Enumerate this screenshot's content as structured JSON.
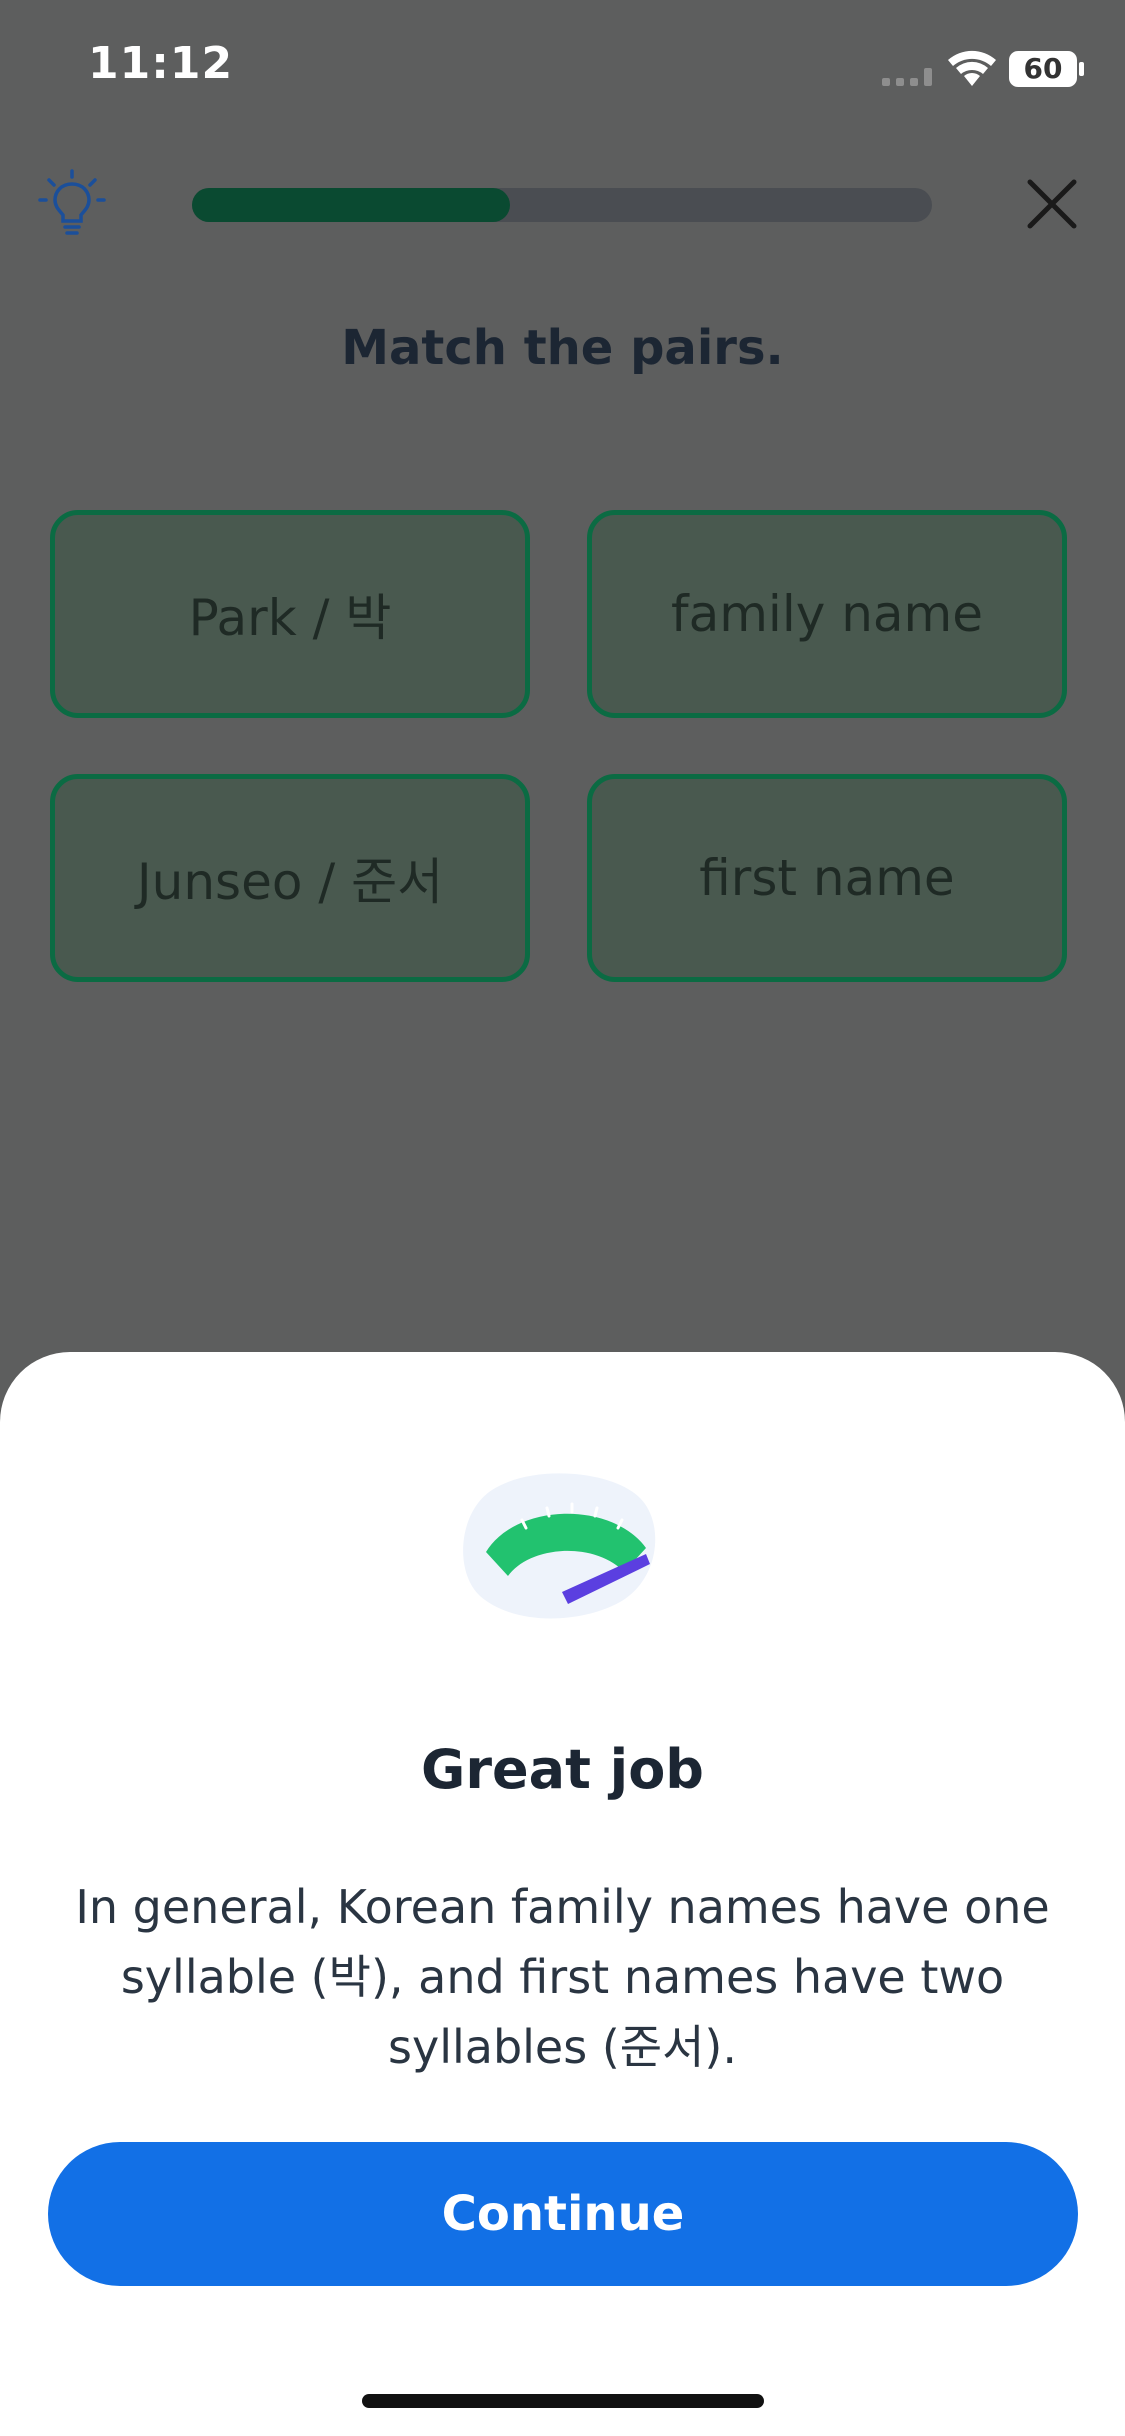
{
  "status_bar": {
    "time": "11:12",
    "battery_level": "60",
    "icons": [
      "cellular-signal-icon",
      "wifi-icon",
      "battery-icon"
    ]
  },
  "header": {
    "hint_icon": "lightbulb-icon",
    "progress_fraction": 0.43,
    "close_icon": "close-icon"
  },
  "exercise": {
    "prompt": "Match the pairs.",
    "pairs": [
      {
        "left": "Park / 박",
        "right": "family name"
      },
      {
        "left": "Junseo / 준서",
        "right": "first name"
      }
    ]
  },
  "feedback": {
    "illustration": "gauge-meter-icon",
    "title": "Great job",
    "body": "In general, Korean family names have one syllable (박), and first names have two syllables (준서).",
    "continue_label": "Continue"
  },
  "colors": {
    "accent_blue": "#1270e6",
    "progress_green": "#0a4a31",
    "match_green": "#0b6b43",
    "gauge_green": "#22c26f",
    "needle_purple": "#5b3fe0"
  }
}
